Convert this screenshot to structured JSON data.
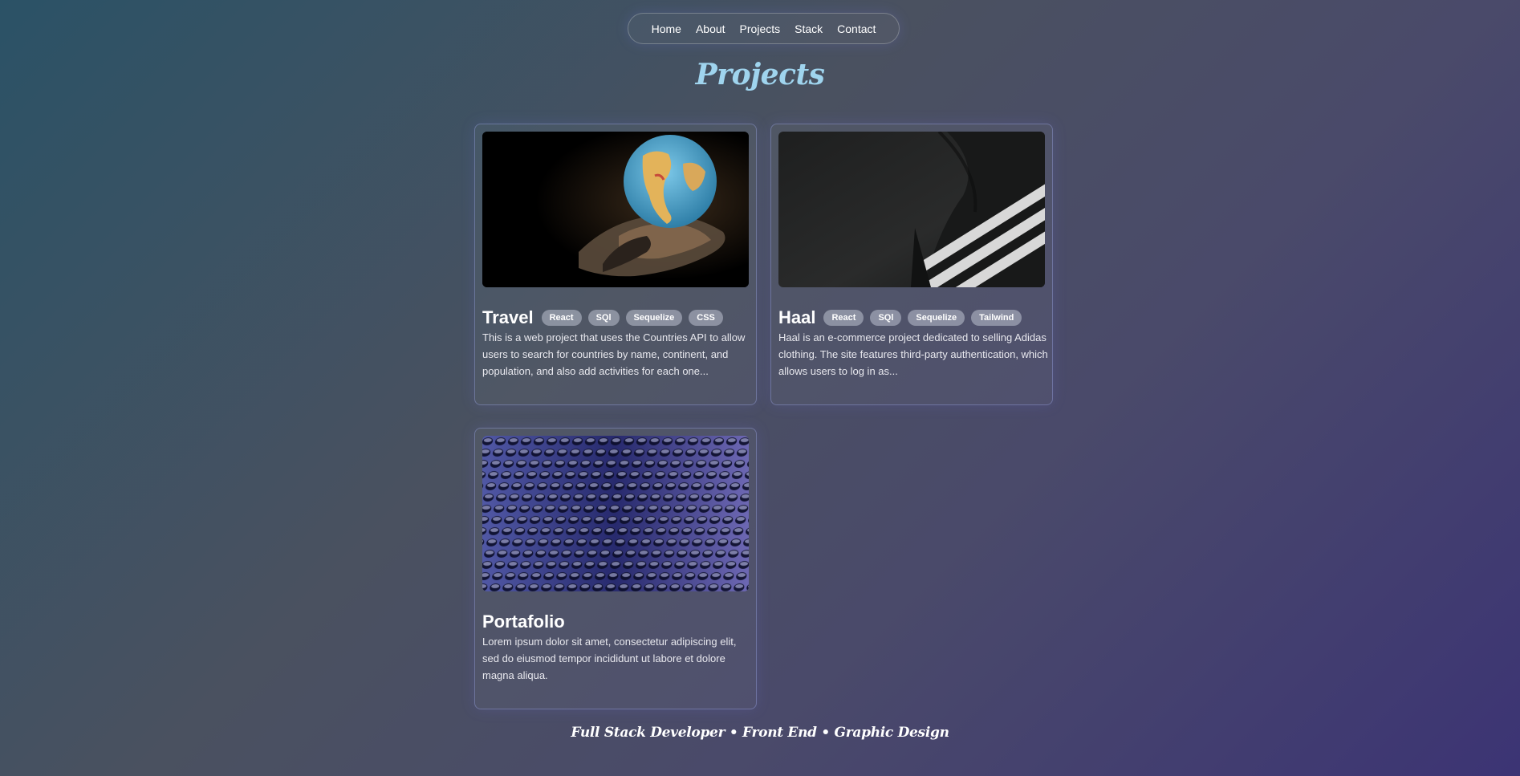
{
  "nav": {
    "items": [
      {
        "label": "Home"
      },
      {
        "label": "About"
      },
      {
        "label": "Projects"
      },
      {
        "label": "Stack"
      },
      {
        "label": "Contact"
      }
    ]
  },
  "page": {
    "title": "Projects",
    "footer_tagline": "Full Stack Developer • Front End • Graphic Design"
  },
  "projects": [
    {
      "title": "Travel",
      "tags": [
        "React",
        "SQl",
        "Sequelize",
        "CSS"
      ],
      "description": "This is a web project that uses the Countries API to allow users to search for countries by name, continent, and population, and also add activities for each one...",
      "image_icon": "globe-in-hand-image"
    },
    {
      "title": "Haal",
      "tags": [
        "React",
        "SQl",
        "Sequelize",
        "Tailwind"
      ],
      "description": "Haal is an e-commerce project dedicated to selling Adidas clothing. The site features third-party authentication, which allows users to log in as...",
      "image_icon": "adidas-stripes-image"
    },
    {
      "title": "Portafolio",
      "tags": [],
      "description": "Lorem ipsum dolor sit amet, consectetur adipiscing elit, sed do eiusmod tempor incididunt ut labore et dolore magna aliqua.",
      "image_icon": "hexagon-mesh-image"
    }
  ],
  "colors": {
    "title_accent": "#9fd4ee",
    "tag_bg": "#9a9fb0",
    "card_border": "#8a90c8"
  }
}
